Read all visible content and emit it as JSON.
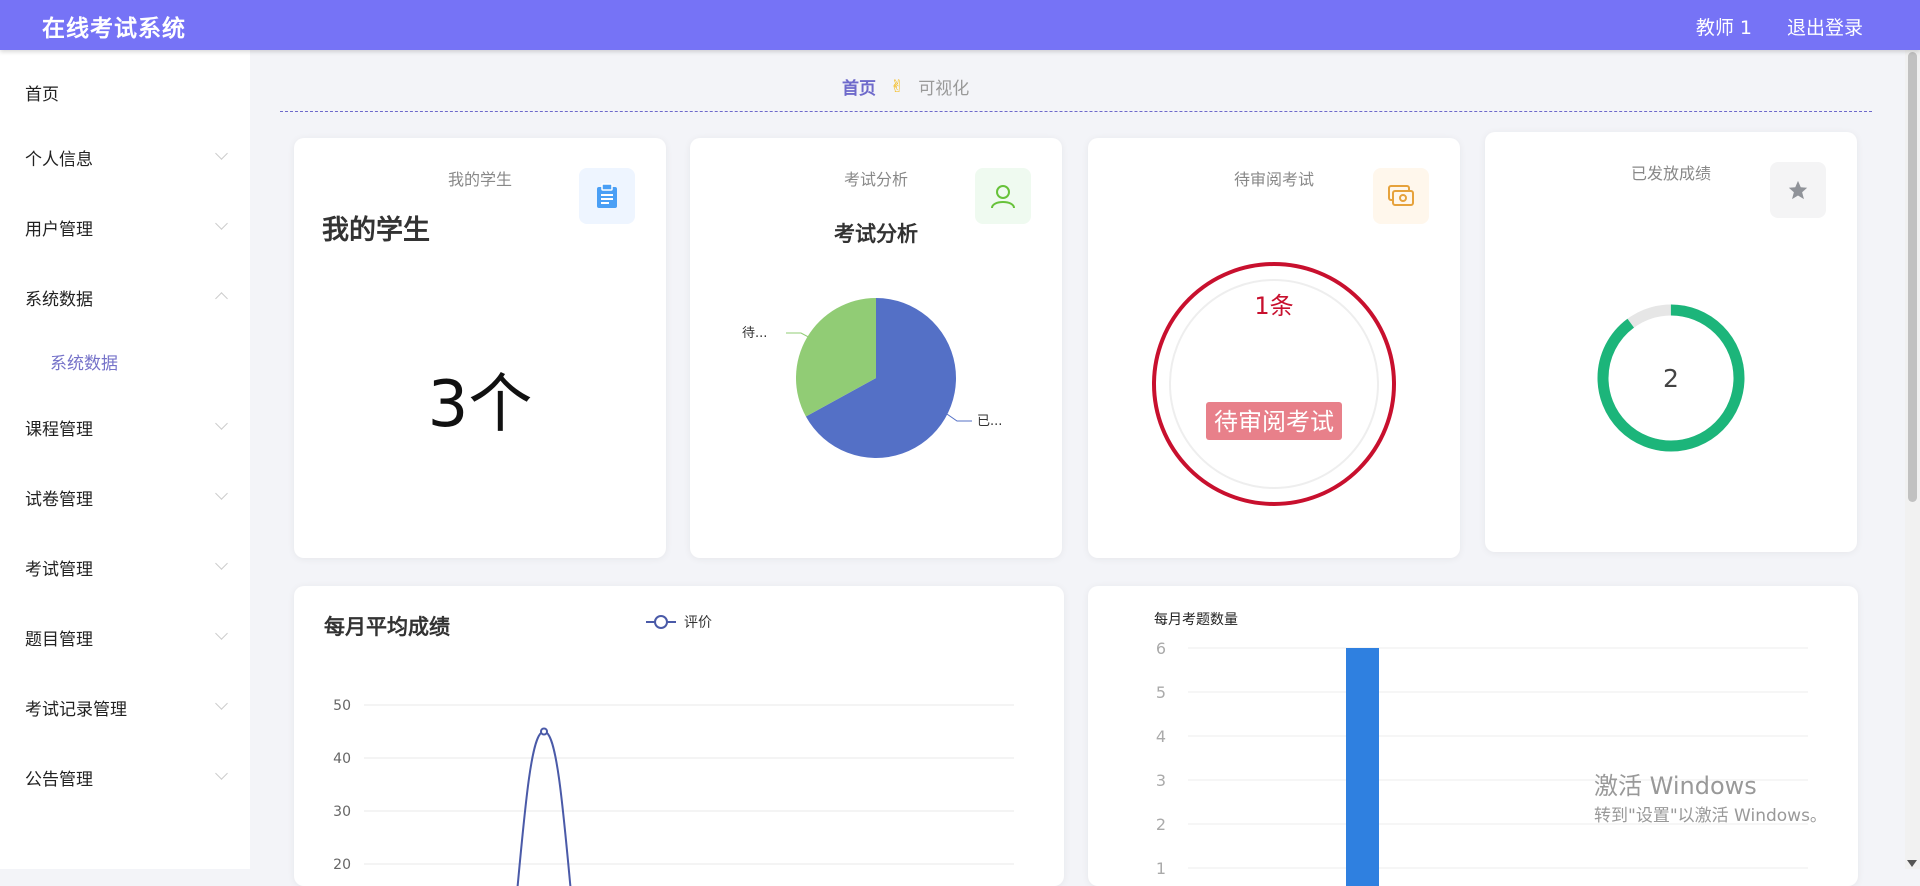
{
  "header": {
    "title": "在线考试系统",
    "user": "教师 1",
    "logout": "退出登录"
  },
  "sidebar": {
    "items": [
      {
        "label": "首页"
      },
      {
        "label": "个人信息"
      },
      {
        "label": "用户管理"
      },
      {
        "label": "系统数据"
      },
      {
        "label": "课程管理"
      },
      {
        "label": "试卷管理"
      },
      {
        "label": "考试管理"
      },
      {
        "label": "题目管理"
      },
      {
        "label": "考试记录管理"
      },
      {
        "label": "公告管理"
      }
    ],
    "subitem": "系统数据"
  },
  "breadcrumb": {
    "home": "首页",
    "current": "可视化"
  },
  "cards": {
    "students": {
      "caption": "我的学生",
      "heading": "我的学生",
      "value": "3个",
      "icon": "clipboard-icon",
      "color": "#4a9ff5"
    },
    "exam_analysis": {
      "caption": "考试分析",
      "heading": "考试分析",
      "icon": "user-icon",
      "color": "#67c23a"
    },
    "pending": {
      "caption": "待审阅考试",
      "count": "1条",
      "label": "待审阅考试",
      "icon": "money-icon",
      "color": "#e6a23c"
    },
    "released": {
      "caption": "已发放成绩",
      "value": "2",
      "icon": "star-icon",
      "color": "#909399"
    }
  },
  "chart_data": [
    {
      "type": "pie",
      "labels": [
        "已...",
        "待..."
      ],
      "values": [
        67,
        33
      ],
      "colors": [
        "#5470c6",
        "#91cc75"
      ]
    },
    {
      "type": "line",
      "title": "每月平均成绩",
      "series": [
        {
          "name": "评价",
          "values": [
            0,
            45,
            0
          ]
        }
      ],
      "yticks": [
        20,
        30,
        40,
        50
      ],
      "color": "#4a5aa8"
    },
    {
      "type": "bar",
      "title": "每月考题数量",
      "values": [
        6
      ],
      "yticks": [
        1,
        2,
        3,
        4,
        5,
        6
      ],
      "color": "#2f80e0"
    }
  ],
  "watermark": {
    "line1": "激活 Windows",
    "line2": "转到\"设置\"以激活 Windows。"
  }
}
